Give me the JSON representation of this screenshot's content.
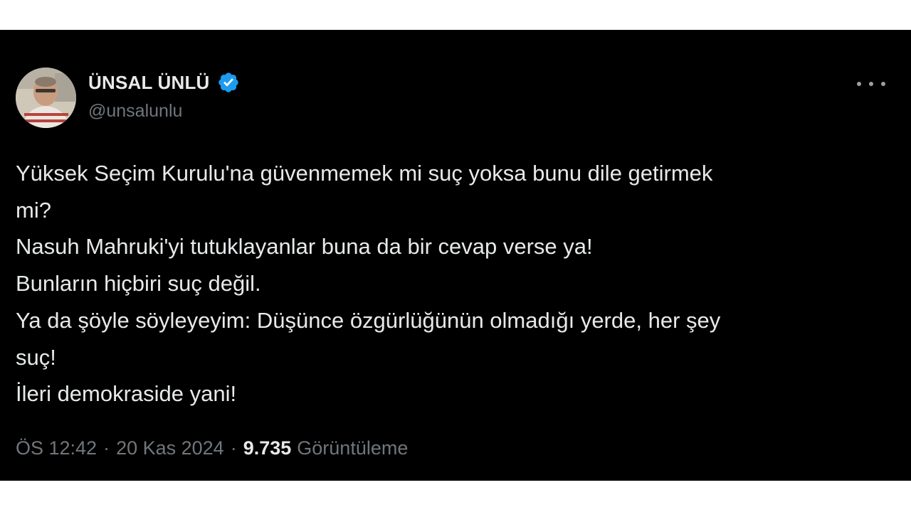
{
  "author": {
    "display_name": "ÜNSAL ÜNLÜ",
    "handle": "@unsalunlu",
    "verified": true
  },
  "icons": {
    "verified": "verified-badge-icon",
    "more": "more-options-icon",
    "avatar": "profile-avatar"
  },
  "colors": {
    "background": "#000000",
    "text": "#e7e9ea",
    "muted": "#71767b",
    "verified_badge": "#1d9bf0"
  },
  "tweet": {
    "lines": [
      "Yüksek Seçim Kurulu'na güvenmemek mi suç yoksa bunu dile getirmek",
      "mi?",
      "Nasuh Mahruki'yi tutuklayanlar buna da bir cevap verse ya!",
      "Bunların hiçbiri suç değil.",
      "Ya da şöyle söyleyeyim: Düşünce özgürlüğünün olmadığı yerde, her şey",
      "suç!",
      "İleri demokraside yani!"
    ]
  },
  "meta": {
    "time": "ÖS 12:42",
    "separator": "·",
    "date": "20 Kas 2024",
    "views_count": "9.735",
    "views_label": "Görüntüleme"
  }
}
